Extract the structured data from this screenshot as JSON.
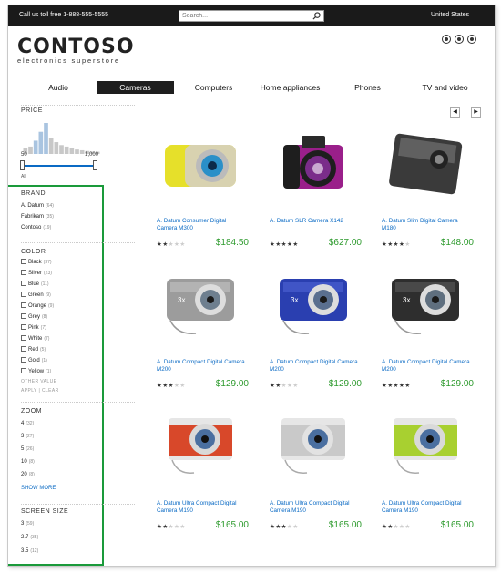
{
  "topbar": {
    "phone": "Call us toll free 1-888-555-5555",
    "search_placeholder": "Search...",
    "country": "United States"
  },
  "logo": {
    "brand": "CONTOSO",
    "tagline": "electronics superstore"
  },
  "nav": [
    {
      "label": "Audio",
      "active": false
    },
    {
      "label": "Cameras",
      "active": true
    },
    {
      "label": "Computers",
      "active": false
    },
    {
      "label": "Home appliances",
      "active": false
    },
    {
      "label": "Phones",
      "active": false
    },
    {
      "label": "TV and video",
      "active": false
    }
  ],
  "price": {
    "title": "PRICE",
    "min_label": "50",
    "max_label": "1,000",
    "all_label": "All"
  },
  "brand": {
    "title": "BRAND",
    "items": [
      {
        "label": "A. Datum",
        "count": "(64)"
      },
      {
        "label": "Fabrikam",
        "count": "(35)"
      },
      {
        "label": "Contoso",
        "count": "(19)"
      }
    ]
  },
  "color": {
    "title": "COLOR",
    "items": [
      {
        "label": "Black",
        "count": "(37)"
      },
      {
        "label": "Silver",
        "count": "(23)"
      },
      {
        "label": "Blue",
        "count": "(11)"
      },
      {
        "label": "Green",
        "count": "(9)"
      },
      {
        "label": "Orange",
        "count": "(9)"
      },
      {
        "label": "Grey",
        "count": "(8)"
      },
      {
        "label": "Pink",
        "count": "(7)"
      },
      {
        "label": "White",
        "count": "(7)"
      },
      {
        "label": "Red",
        "count": "(5)"
      },
      {
        "label": "Gold",
        "count": "(1)"
      },
      {
        "label": "Yellow",
        "count": "(1)"
      }
    ],
    "other_value": "OTHER VALUE",
    "apply": "APPLY",
    "clear": "CLEAR"
  },
  "zoom": {
    "title": "ZOOM",
    "items": [
      {
        "label": "4",
        "count": "(32)"
      },
      {
        "label": "3",
        "count": "(27)"
      },
      {
        "label": "5",
        "count": "(26)"
      },
      {
        "label": "10",
        "count": "(8)"
      },
      {
        "label": "20",
        "count": "(8)"
      }
    ],
    "show_more": "SHOW MORE"
  },
  "screen_size": {
    "title": "SCREEN SIZE",
    "items": [
      {
        "label": "3",
        "count": "(59)"
      },
      {
        "label": "2.7",
        "count": "(35)"
      },
      {
        "label": "3.5",
        "count": "(12)"
      }
    ]
  },
  "pager": {
    "prev": "◀",
    "next": "▶"
  },
  "products": [
    {
      "name": "A. Datum Consumer Digital Camera M300",
      "price": "$184.50",
      "rating": 2,
      "body": "#d8d2b0",
      "accent": "#e6e02a",
      "lens": "#2a8fc8"
    },
    {
      "name": "A. Datum SLR Camera X142",
      "price": "$627.00",
      "rating": 5,
      "body": "#9a1f8a",
      "accent": "#2a2a2a",
      "lens": "#7a2d8a"
    },
    {
      "name": "A. Datum Slim Digital Camera M180",
      "price": "$148.00",
      "rating": 4,
      "body": "#3a3a3a",
      "accent": "#6a6a6a",
      "lens": "#555555"
    },
    {
      "name": "A. Datum Compact Digital Camera M200",
      "price": "$129.00",
      "rating": 3,
      "body": "#9c9c9c",
      "accent": "#bdbdbd",
      "lens": "#6e7f8f"
    },
    {
      "name": "A. Datum Compact Digital Camera M200",
      "price": "$129.00",
      "rating": 2,
      "body": "#2a3fb0",
      "accent": "#4a5fd0",
      "lens": "#5a6f8f"
    },
    {
      "name": "A. Datum Compact Digital Camera M200",
      "price": "$129.00",
      "rating": 5,
      "body": "#2e2e2e",
      "accent": "#555555",
      "lens": "#5f6f7f"
    },
    {
      "name": "A. Datum Ultra Compact Digital Camera M190",
      "price": "$165.00",
      "rating": 2,
      "body": "#d8482a",
      "accent": "#d9d9d9",
      "lens": "#4a6fa0"
    },
    {
      "name": "A. Datum Ultra Compact Digital Camera M190",
      "price": "$165.00",
      "rating": 3,
      "body": "#c9c9c9",
      "accent": "#e2e2e2",
      "lens": "#4a6fa0"
    },
    {
      "name": "A. Datum Ultra Compact Digital Camera M190",
      "price": "$165.00",
      "rating": 2,
      "body": "#a8d030",
      "accent": "#d9d9d9",
      "lens": "#4a6fa0"
    }
  ],
  "price_histogram": [
    8,
    10,
    18,
    30,
    42,
    22,
    16,
    12,
    10,
    8,
    6,
    5,
    4,
    3,
    3
  ]
}
